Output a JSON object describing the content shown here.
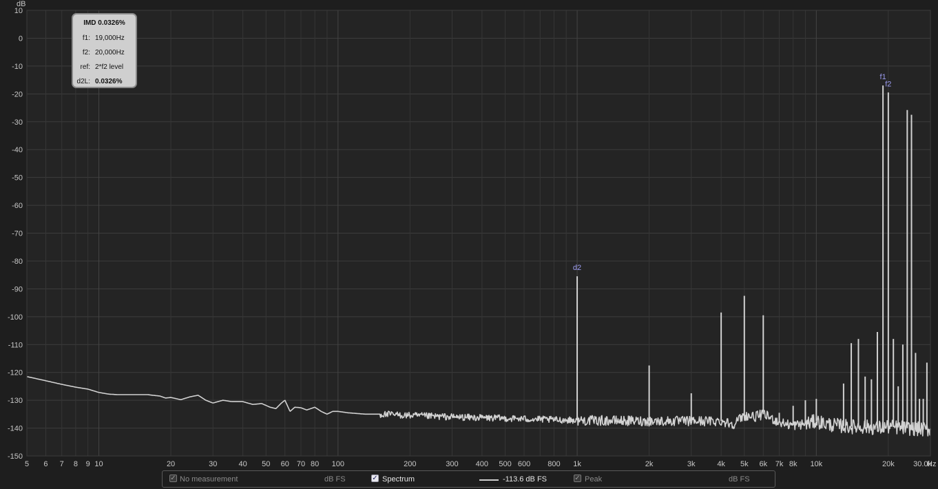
{
  "chart_data": {
    "type": "line",
    "y_unit": "dB",
    "x_unit": "Hz",
    "xlim": [
      5,
      30000
    ],
    "ylim": [
      -150,
      10
    ],
    "x_scale": "log",
    "grid": true,
    "y_ticks": [
      10,
      0,
      -10,
      -20,
      -30,
      -40,
      -50,
      -60,
      -70,
      -80,
      -90,
      -100,
      -110,
      -120,
      -130,
      -140,
      -150
    ],
    "x_ticks": [
      {
        "v": 5,
        "label": "5"
      },
      {
        "v": 6,
        "label": "6"
      },
      {
        "v": 7,
        "label": "7"
      },
      {
        "v": 8,
        "label": "8"
      },
      {
        "v": 9,
        "label": "9"
      },
      {
        "v": 10,
        "label": "10"
      },
      {
        "v": 20,
        "label": "20"
      },
      {
        "v": 30,
        "label": "30"
      },
      {
        "v": 40,
        "label": "40"
      },
      {
        "v": 50,
        "label": "50"
      },
      {
        "v": 60,
        "label": "60"
      },
      {
        "v": 70,
        "label": "70"
      },
      {
        "v": 80,
        "label": "80"
      },
      {
        "v": 100,
        "label": "100"
      },
      {
        "v": 200,
        "label": "200"
      },
      {
        "v": 300,
        "label": "300"
      },
      {
        "v": 400,
        "label": "400"
      },
      {
        "v": 500,
        "label": "500"
      },
      {
        "v": 600,
        "label": "600"
      },
      {
        "v": 800,
        "label": "800"
      },
      {
        "v": 1000,
        "label": "1k"
      },
      {
        "v": 2000,
        "label": "2k"
      },
      {
        "v": 3000,
        "label": "3k"
      },
      {
        "v": 4000,
        "label": "4k"
      },
      {
        "v": 5000,
        "label": "5k"
      },
      {
        "v": 6000,
        "label": "6k"
      },
      {
        "v": 7000,
        "label": "7k"
      },
      {
        "v": 8000,
        "label": "8k"
      },
      {
        "v": 10000,
        "label": "10k"
      },
      {
        "v": 20000,
        "label": "20k"
      },
      {
        "v": 30000,
        "label": "30.0k"
      }
    ],
    "series": [
      {
        "name": "Spectrum",
        "color": "#d2d2d2",
        "noise_floor": [
          [
            5,
            -121.5
          ],
          [
            6,
            -123
          ],
          [
            7,
            -124.3
          ],
          [
            8,
            -125.3
          ],
          [
            9,
            -126
          ],
          [
            10,
            -127.2
          ],
          [
            11,
            -127.8
          ],
          [
            12,
            -128
          ],
          [
            14,
            -128
          ],
          [
            16,
            -128
          ],
          [
            18,
            -128.5
          ],
          [
            19,
            -129.2
          ],
          [
            20,
            -129
          ],
          [
            22,
            -129.8
          ],
          [
            24,
            -128.8
          ],
          [
            26,
            -128.2
          ],
          [
            28,
            -130
          ],
          [
            30,
            -131
          ],
          [
            33,
            -130
          ],
          [
            36,
            -130.5
          ],
          [
            40,
            -130.5
          ],
          [
            44,
            -131.5
          ],
          [
            48,
            -131.2
          ],
          [
            52,
            -132.5
          ],
          [
            55,
            -133
          ],
          [
            58,
            -131
          ],
          [
            60,
            -130
          ],
          [
            63,
            -134
          ],
          [
            66,
            -132.5
          ],
          [
            70,
            -132.7
          ],
          [
            74,
            -133.5
          ],
          [
            80,
            -132.5
          ],
          [
            85,
            -134
          ],
          [
            90,
            -135
          ],
          [
            95,
            -134
          ],
          [
            100,
            -134
          ],
          [
            110,
            -134.5
          ],
          [
            130,
            -135
          ],
          [
            150,
            -135
          ],
          [
            170,
            -135.2
          ],
          [
            200,
            -135.5
          ],
          [
            300,
            -136
          ],
          [
            500,
            -136.5
          ],
          [
            800,
            -137
          ],
          [
            1000,
            -137.2
          ],
          [
            2000,
            -137.5
          ],
          [
            4000,
            -137.5
          ],
          [
            4500,
            -138.5
          ],
          [
            5000,
            -135.5
          ],
          [
            5500,
            -136
          ],
          [
            6000,
            -135
          ],
          [
            6500,
            -136.5
          ],
          [
            7000,
            -138
          ],
          [
            8000,
            -139
          ],
          [
            9000,
            -138.5
          ],
          [
            10000,
            -137.5
          ],
          [
            11000,
            -138.5
          ],
          [
            12000,
            -139
          ],
          [
            14000,
            -139.5
          ],
          [
            16000,
            -139.5
          ],
          [
            18000,
            -140
          ],
          [
            20000,
            -139.5
          ],
          [
            24000,
            -140
          ],
          [
            28000,
            -140.5
          ],
          [
            30000,
            -140.5
          ]
        ],
        "peaks": [
          {
            "f": 1000,
            "db": -85.5
          },
          {
            "f": 2000,
            "db": -117.5
          },
          {
            "f": 3000,
            "db": -127.5
          },
          {
            "f": 4000,
            "db": -98.5
          },
          {
            "f": 5000,
            "db": -92.5
          },
          {
            "f": 6000,
            "db": -99.5
          },
          {
            "f": 7000,
            "db": -134.5
          },
          {
            "f": 8000,
            "db": -132
          },
          {
            "f": 9000,
            "db": -130
          },
          {
            "f": 10000,
            "db": -129.5
          },
          {
            "f": 13000,
            "db": -124
          },
          {
            "f": 14000,
            "db": -109.5
          },
          {
            "f": 15000,
            "db": -108
          },
          {
            "f": 16000,
            "db": -121.5
          },
          {
            "f": 17000,
            "db": -122.5
          },
          {
            "f": 18000,
            "db": -105.5
          },
          {
            "f": 19000,
            "db": -17
          },
          {
            "f": 20000,
            "db": -19.5
          },
          {
            "f": 21000,
            "db": -108
          },
          {
            "f": 22000,
            "db": -125
          },
          {
            "f": 23000,
            "db": -110
          },
          {
            "f": 24000,
            "db": -25.8
          },
          {
            "f": 25000,
            "db": -27.5
          },
          {
            "f": 26000,
            "db": -113
          },
          {
            "f": 27000,
            "db": -129.5
          },
          {
            "f": 28000,
            "db": -129.5
          },
          {
            "f": 29000,
            "db": -116.5
          }
        ]
      }
    ],
    "annotations": [
      {
        "label": "d2",
        "f": 1000,
        "db": -85.5
      },
      {
        "label": "f1",
        "f": 19000,
        "db": -17
      },
      {
        "label": "f2",
        "f": 20000,
        "db": -19.5
      }
    ]
  },
  "imd_box": {
    "title": "IMD 0.0326%",
    "rows": [
      {
        "key": "f1:",
        "value": "19,000Hz"
      },
      {
        "key": "f2:",
        "value": "20,000Hz"
      },
      {
        "key": "ref:",
        "value": "2*f2 level"
      },
      {
        "key": "d2L:",
        "value": "0.0326%"
      }
    ]
  },
  "legend": {
    "no_measurement_label": "No measurement",
    "no_measurement_unit": "dB FS",
    "spectrum_label": "Spectrum",
    "spectrum_value": "-113.6 dB FS",
    "peak_label": "Peak",
    "peak_unit": "dB FS",
    "no_measurement_checked": true,
    "spectrum_checked": true,
    "peak_checked": true
  }
}
